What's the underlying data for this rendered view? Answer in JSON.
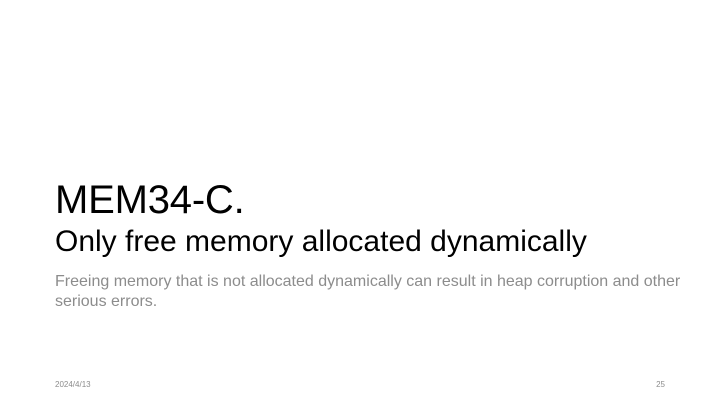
{
  "slide": {
    "title_line1": "MEM34-C.",
    "title_line2": "Only free memory allocated dynamically",
    "subtitle": "Freeing memory that is not allocated dynamically can result in heap corruption and other serious errors.",
    "footer_date": "2024/4/13",
    "page_number": "25"
  },
  "colors": {
    "background": "#ffffff",
    "title": "#000000",
    "subtitle": "#8c8c8c",
    "footer": "#8c8c8c"
  }
}
